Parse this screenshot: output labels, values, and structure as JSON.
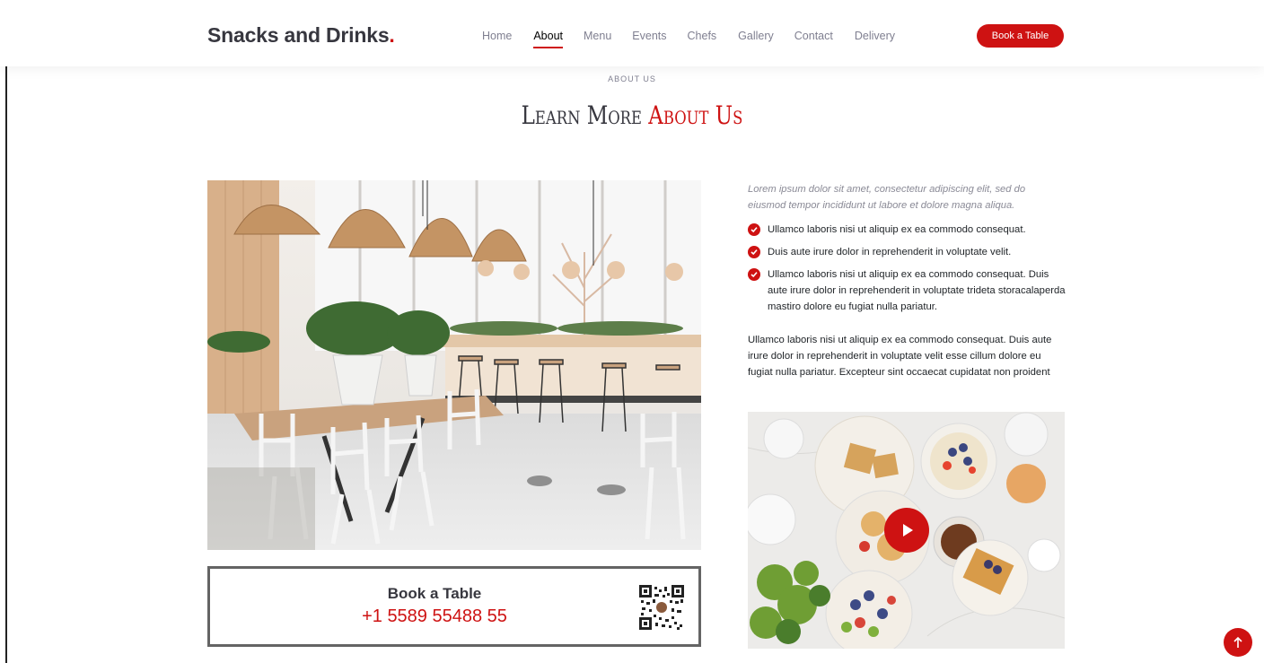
{
  "header": {
    "logo_text": "Snacks and Drinks",
    "logo_dot": ".",
    "nav": [
      {
        "label": "Home"
      },
      {
        "label": "About"
      },
      {
        "label": "Menu"
      },
      {
        "label": "Events"
      },
      {
        "label": "Chefs"
      },
      {
        "label": "Gallery"
      },
      {
        "label": "Contact"
      },
      {
        "label": "Delivery"
      }
    ],
    "active_nav": "About",
    "cta_label": "Book a Table"
  },
  "section": {
    "subtitle": "ABOUT US",
    "title_part1": "Learn More",
    "title_part2": "About Us"
  },
  "booking": {
    "title": "Book a Table",
    "phone": "+1 5589 55488 55"
  },
  "about": {
    "lead": "Lorem ipsum dolor sit amet, consectetur adipiscing elit, sed do eiusmod tempor incididunt ut labore et dolore magna aliqua.",
    "checks": [
      "Ullamco laboris nisi ut aliquip ex ea commodo consequat.",
      "Duis aute irure dolor in reprehenderit in voluptate velit.",
      "Ullamco laboris nisi ut aliquip ex ea commodo consequat. Duis aute irure dolor in reprehenderit in voluptate trideta storacalaperda mastiro dolore eu fugiat nulla pariatur."
    ],
    "paragraph": "Ullamco laboris nisi ut aliquip ex ea commodo consequat. Duis aute irure dolor in reprehenderit in voluptate velit esse cillum dolore eu fugiat nulla pariatur. Excepteur sint occaecat cupidatat non proident"
  },
  "icons": {
    "check": "check-circle-icon",
    "play": "play-icon",
    "scroll_top": "arrow-up-icon",
    "qr": "qr-code-icon"
  },
  "colors": {
    "accent": "#ce1212",
    "heading": "#37373f",
    "muted": "#7f7f90"
  }
}
